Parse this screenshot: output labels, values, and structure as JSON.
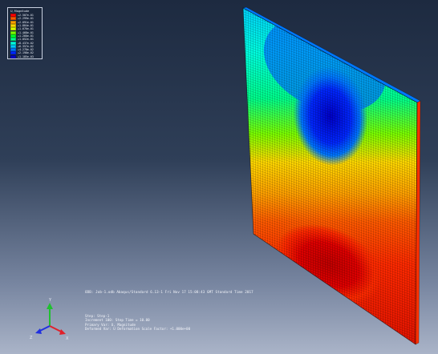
{
  "legend": {
    "title": "U, Magnitude",
    "entries": [
      {
        "value": "+2.507e-01",
        "color": "#ff0000"
      },
      {
        "value": "+2.299e-01",
        "color": "#ff5a00"
      },
      {
        "value": "+2.091e-01",
        "color": "#ffa000"
      },
      {
        "value": "+1.884e-01",
        "color": "#ffd800"
      },
      {
        "value": "+1.676e-01",
        "color": "#d8ff00"
      },
      {
        "value": "+1.468e-01",
        "color": "#7cff00"
      },
      {
        "value": "+1.260e-01",
        "color": "#00ff28"
      },
      {
        "value": "+1.052e-01",
        "color": "#00ff8c"
      },
      {
        "value": "+8.437e-02",
        "color": "#00ffe0"
      },
      {
        "value": "+6.357e-02",
        "color": "#00c8ff"
      },
      {
        "value": "+4.278e-02",
        "color": "#0078ff"
      },
      {
        "value": "+2.198e-02",
        "color": "#0028ff"
      },
      {
        "value": "+1.185e-03",
        "color": "#0000c8"
      }
    ]
  },
  "status_line": "ODB: Job-1.odb    Abaqus/Standard 6.13-1    Fri Nov 17 15:08:43 GMT Standard Time 2017",
  "info": {
    "step": "Step: Step-1",
    "increment": "Increment    100: Step Time =    10.00",
    "primary_var": "Primary Var: U, Magnitude",
    "deformed_var": "Deformed Var: U   Deformation Scale Factor: +1.000e+00"
  },
  "triad": {
    "x_label": "X",
    "y_label": "Y",
    "z_label": "Z",
    "x_color": "#e0202a",
    "y_color": "#20c030",
    "z_color": "#2030e0"
  }
}
